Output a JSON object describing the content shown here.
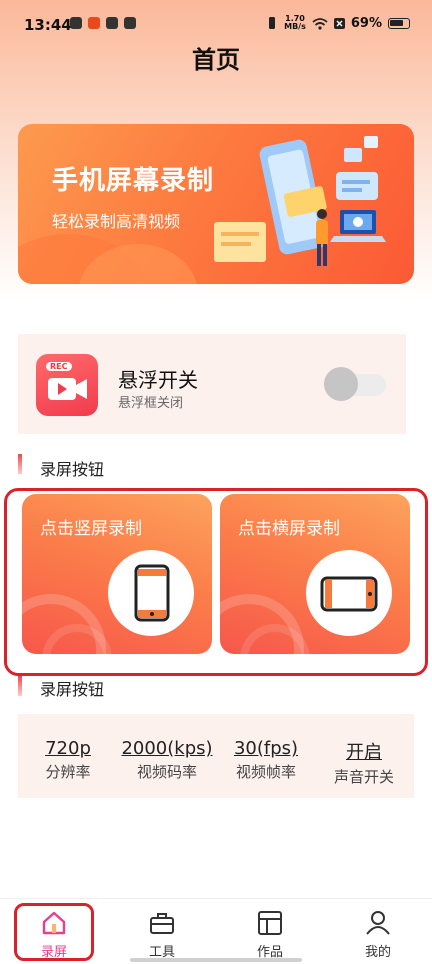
{
  "status_bar": {
    "time": "13:44",
    "net_speed_top": "1.70",
    "net_speed_bottom": "MB/s",
    "battery": "69%"
  },
  "page": {
    "title": "首页"
  },
  "banner": {
    "title": "手机屏幕录制",
    "subtitle": "轻松录制高清视频"
  },
  "float_switch": {
    "rec_badge": "REC",
    "title": "悬浮开关",
    "subtitle": "悬浮框关闭",
    "enabled": false
  },
  "section_record": {
    "title": "录屏按钮"
  },
  "record_buttons": [
    {
      "label": "点击竖屏录制",
      "icon": "portrait-phone-icon"
    },
    {
      "label": "点击横屏录制",
      "icon": "landscape-phone-icon"
    }
  ],
  "section_settings": {
    "title": "录屏按钮"
  },
  "settings": [
    {
      "value": "720p",
      "label": "分辨率"
    },
    {
      "value": "2000(kps)",
      "label": "视频码率"
    },
    {
      "value": "30(fps)",
      "label": "视频帧率"
    },
    {
      "value": "开启",
      "label": "声音开关"
    }
  ],
  "nav": [
    {
      "label": "录屏",
      "icon": "home-icon",
      "active": true
    },
    {
      "label": "工具",
      "icon": "toolbox-icon",
      "active": false
    },
    {
      "label": "作品",
      "icon": "works-icon",
      "active": false
    },
    {
      "label": "我的",
      "icon": "profile-icon",
      "active": false
    }
  ],
  "colors": {
    "accent": "#fb5a35",
    "nav_active": "#e6418a",
    "highlight": "#d9232a"
  }
}
